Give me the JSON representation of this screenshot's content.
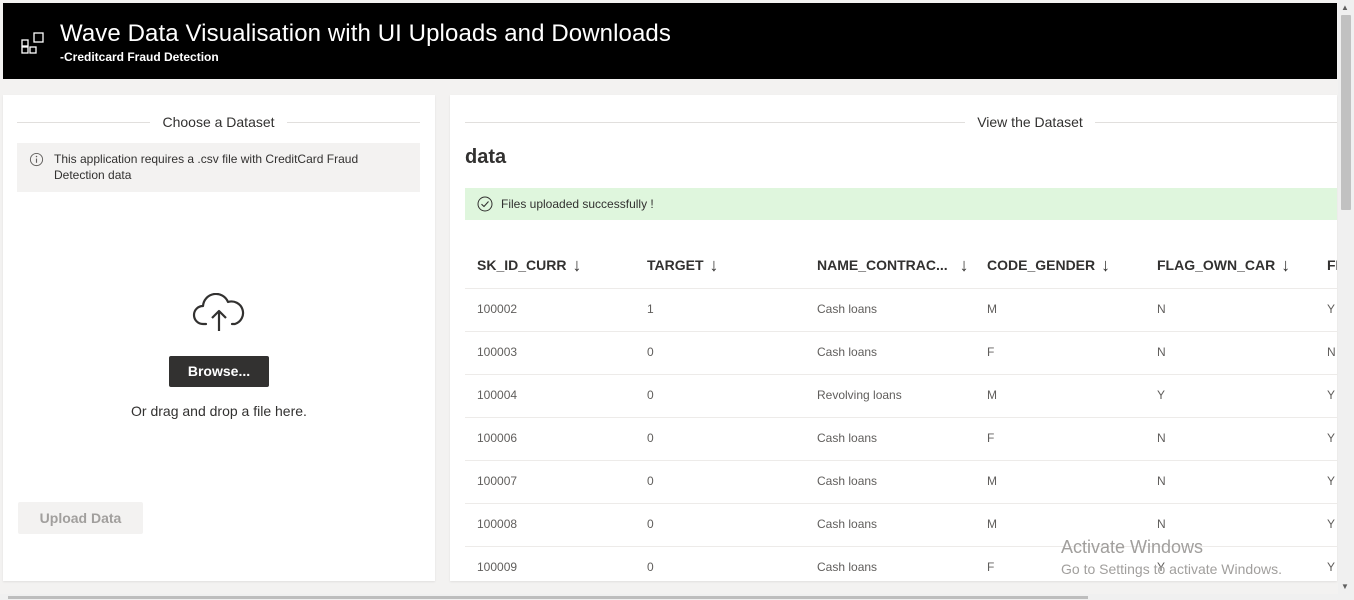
{
  "header": {
    "title": "Wave Data Visualisation with UI Uploads and Downloads",
    "subtitle": "-Creditcard Fraud Detection",
    "logo_icon": "app-grid-icon"
  },
  "left_panel": {
    "section_title": "Choose a Dataset",
    "info_message": "This application requires a .csv file with CreditCard Fraud Detection data",
    "info_icon": "info-icon",
    "upload_icon": "cloud-upload-icon",
    "browse_label": "Browse...",
    "drop_text": "Or drag and drop a file here.",
    "upload_button_label": "Upload Data"
  },
  "right_panel": {
    "section_title": "View the Dataset",
    "data_title": "data",
    "success_message": "Files uploaded successfully !",
    "success_icon": "check-circle-icon",
    "table": {
      "columns": [
        "SK_ID_CURR",
        "TARGET",
        "NAME_CONTRAC...",
        "CODE_GENDER",
        "FLAG_OWN_CAR",
        "FL"
      ],
      "sort_arrow": "↓",
      "rows": [
        [
          "100002",
          "1",
          "Cash loans",
          "M",
          "N",
          "Y"
        ],
        [
          "100003",
          "0",
          "Cash loans",
          "F",
          "N",
          "N"
        ],
        [
          "100004",
          "0",
          "Revolving loans",
          "M",
          "Y",
          "Y"
        ],
        [
          "100006",
          "0",
          "Cash loans",
          "F",
          "N",
          "Y"
        ],
        [
          "100007",
          "0",
          "Cash loans",
          "M",
          "N",
          "Y"
        ],
        [
          "100008",
          "0",
          "Cash loans",
          "M",
          "N",
          "Y"
        ],
        [
          "100009",
          "0",
          "Cash loans",
          "F",
          "Y",
          "Y"
        ]
      ]
    }
  },
  "watermark": {
    "line1": "Activate Windows",
    "line2": "Go to Settings to activate Windows."
  },
  "colors": {
    "header_bg": "#000000",
    "success_bg": "#dff6dd",
    "primary_button": "#323130"
  }
}
